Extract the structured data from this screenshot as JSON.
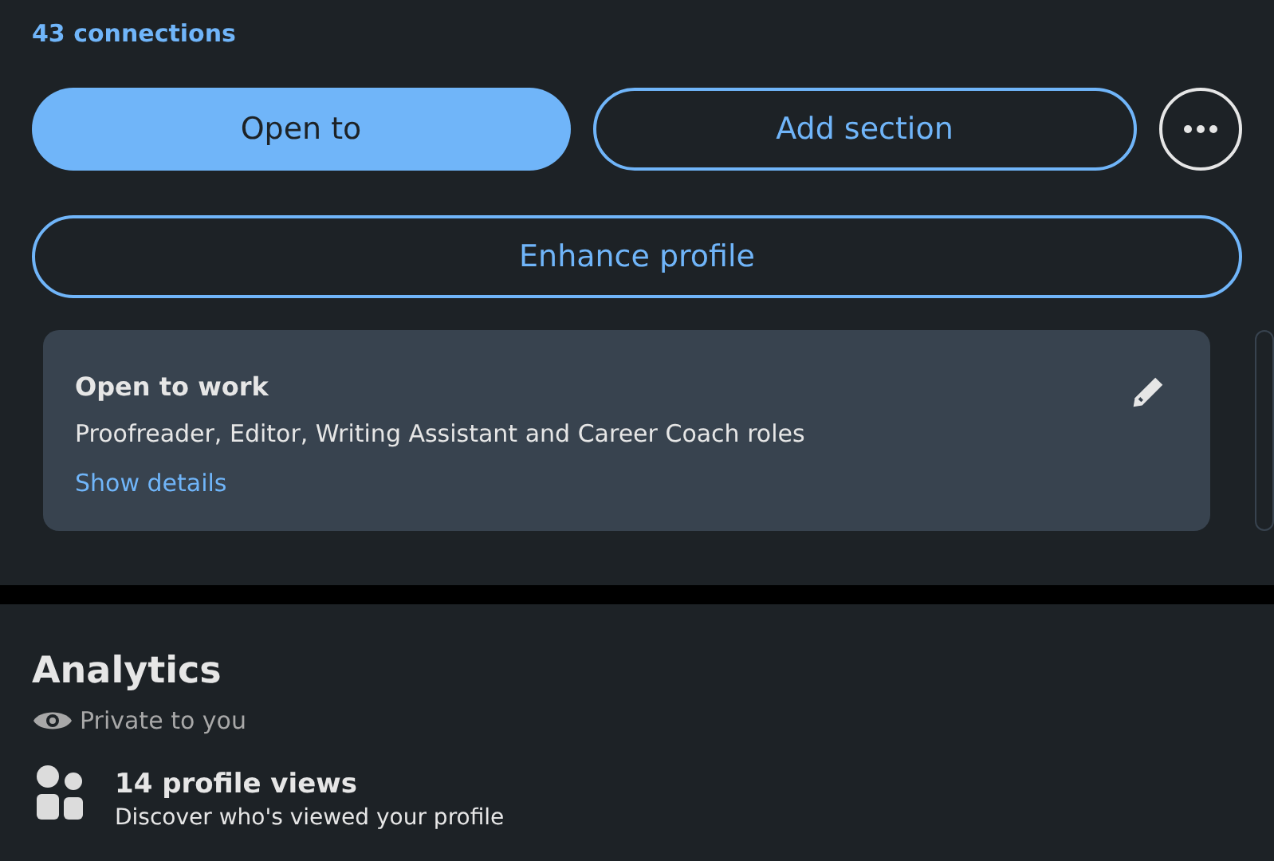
{
  "connections": "43 connections",
  "buttons": [
    {
      "label": "Open to",
      "kind": "primary"
    },
    {
      "label": "Add section",
      "kind": "outline"
    },
    {
      "label": "Enhance profile",
      "kind": "wide"
    }
  ],
  "open_to_work": {
    "title": "Open to work",
    "roles": "Proofreader, Editor, Writing Assistant and Career Coach roles",
    "link": "Show details"
  },
  "analytics": {
    "title": "Analytics",
    "privacy": "Private to you",
    "items": [
      {
        "title": "14 profile views",
        "subtitle": "Discover who's viewed your profile"
      }
    ]
  }
}
